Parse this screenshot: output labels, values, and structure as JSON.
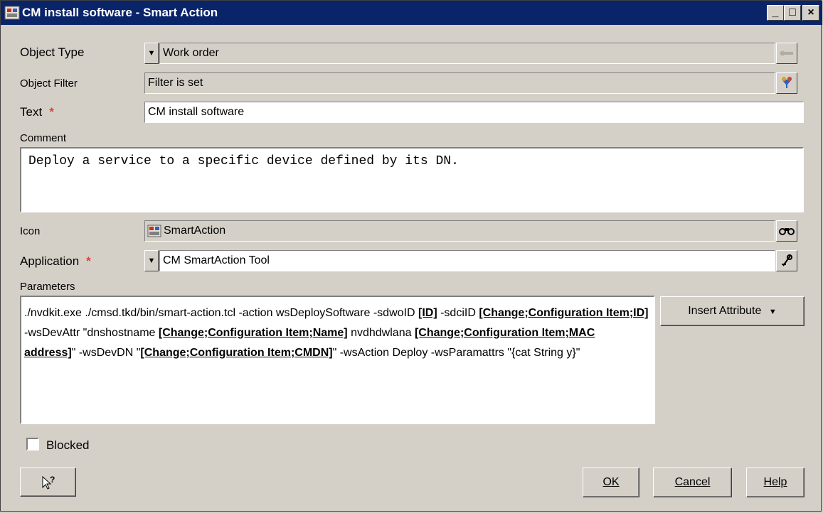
{
  "window": {
    "title": "CM install software - Smart Action",
    "minimize": "_",
    "maximize": "□",
    "close": "×"
  },
  "object_type": {
    "label": "Object Type",
    "value": "Work order"
  },
  "object_filter": {
    "label": "Object Filter",
    "value": "Filter is set"
  },
  "text_field": {
    "label": "Text",
    "required": "*",
    "value": "CM install software"
  },
  "comment": {
    "label": "Comment",
    "value": "Deploy a service to a specific device defined by its DN."
  },
  "icon_field": {
    "label": "Icon",
    "value": "SmartAction"
  },
  "application": {
    "label": "Application",
    "required": "*",
    "value": "CM SmartAction Tool"
  },
  "parameters": {
    "label": "Parameters",
    "segments": [
      {
        "text": "./nvdkit.exe ./cmsd.tkd/bin/smart-action.tcl -action wsDeploySoftware -sdwoID ",
        "bold": false
      },
      {
        "text": "[ID]",
        "bold": true
      },
      {
        "text": " -sdciID ",
        "bold": false
      },
      {
        "text": "[Change;Configuration Item;ID]",
        "bold": true
      },
      {
        "text": " -wsDevAttr \"dnshostname ",
        "bold": false
      },
      {
        "text": "[Change;Configuration Item;Name]",
        "bold": true
      },
      {
        "text": " nvdhdwlana ",
        "bold": false
      },
      {
        "text": "[Change;Configuration Item;MAC address]",
        "bold": true
      },
      {
        "text": "\" -wsDevDN \"",
        "bold": false
      },
      {
        "text": "[Change;Configuration Item;CMDN]",
        "bold": true
      },
      {
        "text": "\" -wsAction Deploy -wsParamattrs \"{cat String y}\"",
        "bold": false
      }
    ]
  },
  "insert_attribute": {
    "label": "Insert Attribute"
  },
  "blocked": {
    "label": "Blocked",
    "checked": false
  },
  "buttons": {
    "ok": "OK",
    "cancel": "Cancel",
    "help": "Help"
  },
  "colors": {
    "titlebar": "#0a246a",
    "background": "#d4d0c8",
    "required": "#e04030"
  }
}
